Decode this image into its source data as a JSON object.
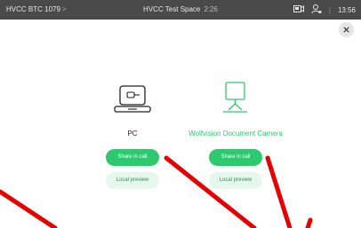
{
  "header": {
    "device_name": "HVCC BTC 1079",
    "device_chevron": ">",
    "space_name": "HVCC Test Space",
    "call_duration": "2:26",
    "divider": "|",
    "clock": "13:56"
  },
  "options": [
    {
      "title": "PC",
      "icon": "laptop-icon",
      "share_label": "Share in call",
      "preview_label": "Local preview"
    },
    {
      "title": "Wolfvision Document Camera",
      "icon": "document-camera-icon",
      "share_label": "Share in call",
      "preview_label": "Local preview"
    }
  ],
  "colors": {
    "accent": "#2ec96e",
    "topbar": "#4a4a4a",
    "annotation_red": "#e60000"
  }
}
